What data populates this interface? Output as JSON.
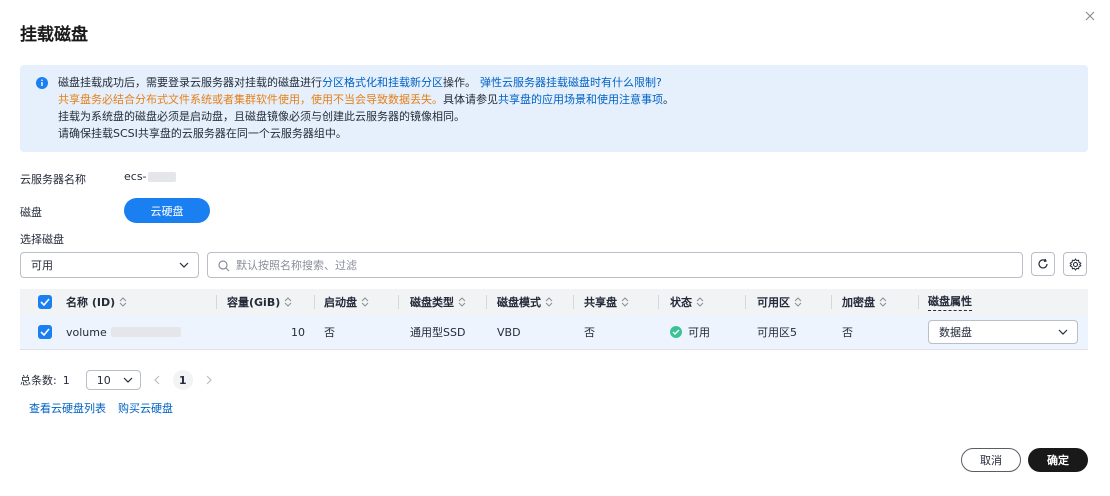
{
  "dialog": {
    "title": "挂载磁盘"
  },
  "notice": {
    "line1_prefix": "磁盘挂载成功后，需要登录云服务器对挂载的磁盘进行",
    "line1_link": "分区格式化和挂载新分区",
    "line1_suffix": "操作。",
    "line1_link2": "弹性云服务器挂载磁盘时有什么限制?",
    "line2_warning": "共享盘务必结合分布式文件系统或者集群软件使用，使用不当会导致数据丢失。",
    "line2_mid": "具体请参见",
    "line2_link": "共享盘的应用场景和使用注意事项",
    "line2_end": "。",
    "line3": "挂载为系统盘的磁盘必须是启动盘，且磁盘镜像必须与创建此云服务器的镜像相同。",
    "line4": "请确保挂载SCSI共享盘的云服务器在同一个云服务器组中。"
  },
  "form": {
    "server_name_label": "云服务器名称",
    "server_name_value": "ecs-",
    "disk_label": "磁盘",
    "disk_type_button": "云硬盘",
    "select_disk_label": "选择磁盘"
  },
  "filter": {
    "status_value": "可用",
    "search_placeholder": "默认按照名称搜索、过滤"
  },
  "table": {
    "headers": {
      "name": "名称 (ID)",
      "capacity": "容量(GiB)",
      "boot": "启动盘",
      "disk_type": "磁盘类型",
      "disk_mode": "磁盘模式",
      "shared": "共享盘",
      "status": "状态",
      "az": "可用区",
      "encrypted": "加密盘",
      "attribute": "磁盘属性"
    },
    "rows": [
      {
        "name": "volume",
        "capacity": "10",
        "boot": "否",
        "disk_type": "通用型SSD",
        "disk_mode": "VBD",
        "shared": "否",
        "status": "可用",
        "az": "可用区5",
        "encrypted": "否",
        "attribute": "数据盘"
      }
    ]
  },
  "pagination": {
    "total_label": "总条数:",
    "total": "1",
    "page_size": "10",
    "current_page": "1"
  },
  "links": {
    "view_list": "查看云硬盘列表",
    "buy": "购买云硬盘"
  },
  "actions": {
    "cancel": "取消",
    "confirm": "确定"
  },
  "colors": {
    "primary": "#1a7ff0",
    "link": "#0062c4",
    "warning": "#e58019",
    "notice_bg": "#e5f0fc",
    "success": "#3ac295"
  }
}
